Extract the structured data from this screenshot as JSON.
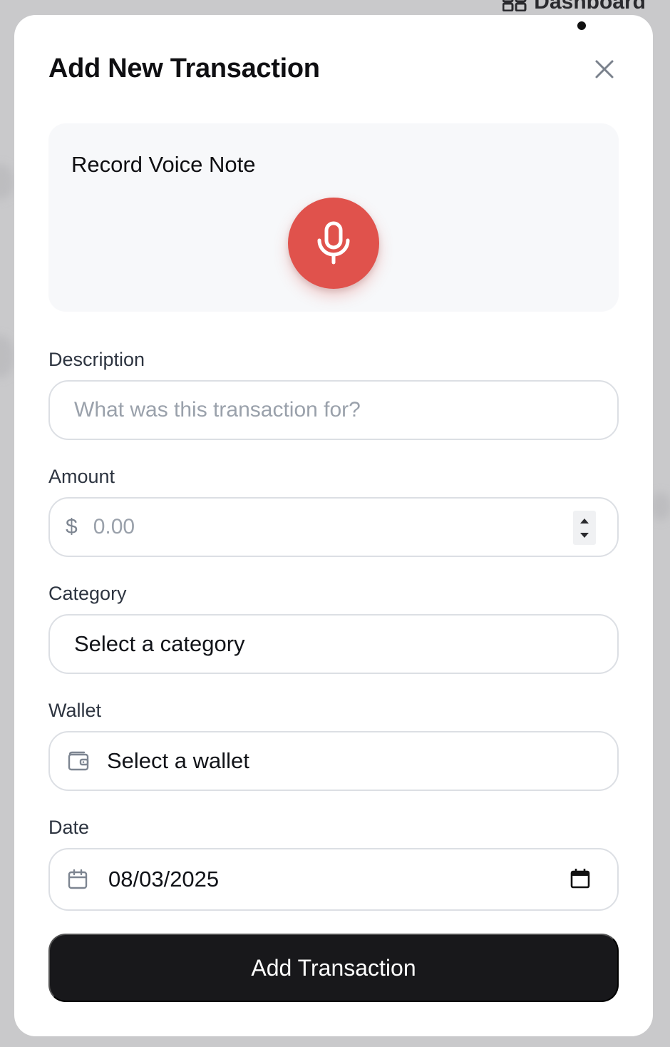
{
  "background": {
    "nav_label": "Dashboard"
  },
  "modal": {
    "title": "Add New Transaction",
    "close_icon": "close-icon"
  },
  "voice_note": {
    "title": "Record Voice Note",
    "button_icon": "microphone-icon",
    "button_color": "#e0524c"
  },
  "form": {
    "description": {
      "label": "Description",
      "placeholder": "What was this transaction for?"
    },
    "amount": {
      "label": "Amount",
      "currency_symbol": "$",
      "placeholder": "0.00"
    },
    "category": {
      "label": "Category",
      "value": "Select a category"
    },
    "wallet": {
      "label": "Wallet",
      "icon": "wallet-icon",
      "value": "Select a wallet"
    },
    "date": {
      "label": "Date",
      "icon": "calendar-icon",
      "value": "08/03/2025",
      "picker_icon": "calendar-picker-icon"
    }
  },
  "submit": {
    "label": "Add Transaction",
    "color": "#18181b"
  }
}
